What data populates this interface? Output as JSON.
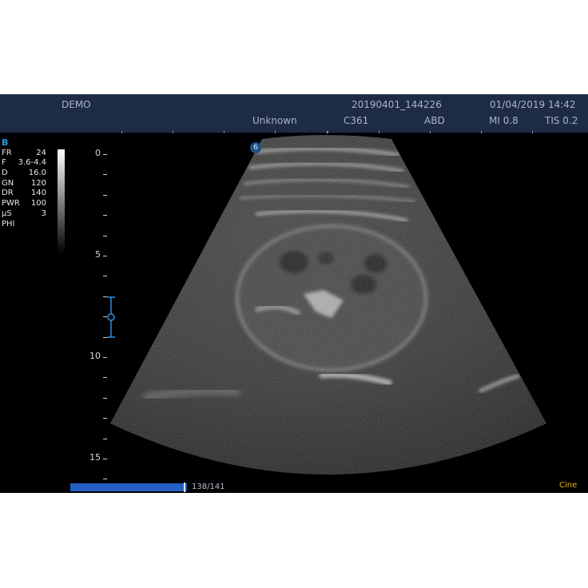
{
  "header": {
    "operator": "DEMO",
    "exam_id": "20190401_144226",
    "datetime": "01/04/2019 14:42",
    "patient": "Unknown",
    "probe": "C361",
    "preset": "ABD",
    "mi": "MI 0.8",
    "tis": "TIS 0.2"
  },
  "params": {
    "mode": "B",
    "rows": [
      {
        "key": "FR",
        "value": "24"
      },
      {
        "key": "F",
        "value": "3.6-4.4"
      },
      {
        "key": "D",
        "value": "16.0"
      },
      {
        "key": "GN",
        "value": "120"
      },
      {
        "key": "DR",
        "value": "140"
      },
      {
        "key": "PWR",
        "value": "100"
      },
      {
        "key": "µS",
        "value": "3"
      },
      {
        "key": "PHI",
        "value": ""
      }
    ]
  },
  "depth_scale": {
    "labels": [
      "0",
      "5",
      "10",
      "15"
    ],
    "max_depth": 16.0
  },
  "probe_marker": "6",
  "footer": {
    "frame_counter": "138/141",
    "frame_current": 138,
    "frame_total": 141,
    "cine_label": "Cine"
  },
  "icons": [
    "focus-marker-icon",
    "probe-orientation-icon"
  ],
  "colors": {
    "header_bg": "#1d2b44",
    "mode_label": "#1e9be8",
    "cine": "#f0b400",
    "progress": "#2361c2"
  }
}
